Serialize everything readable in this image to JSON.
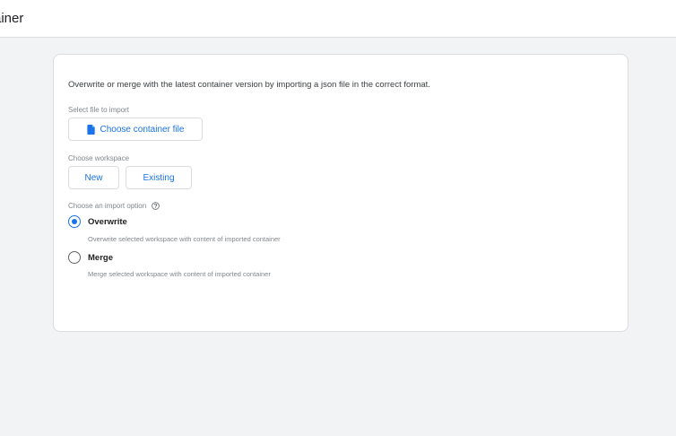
{
  "header": {
    "title": "ainer"
  },
  "card": {
    "intro": "Overwrite or merge with the latest container version by importing a json file in the correct format.",
    "file_section": {
      "label": "Select file to import",
      "button_label": "Choose container file",
      "button_icon": "file-icon"
    },
    "workspace_section": {
      "label": "Choose workspace",
      "buttons": [
        {
          "label": "New"
        },
        {
          "label": "Existing"
        }
      ]
    },
    "import_section": {
      "label": "Choose an import option",
      "help_icon": "help-circle-icon",
      "options": [
        {
          "label": "Overwrite",
          "description": "Overwrite selected workspace with content of imported container",
          "selected": true
        },
        {
          "label": "Merge",
          "description": "Merge selected workspace with content of imported container",
          "selected": false
        }
      ]
    }
  },
  "colors": {
    "accent": "#1a73e8",
    "background": "#f1f3f4",
    "card": "#ffffff",
    "border": "#dadce0",
    "muted_text": "#80868b"
  }
}
